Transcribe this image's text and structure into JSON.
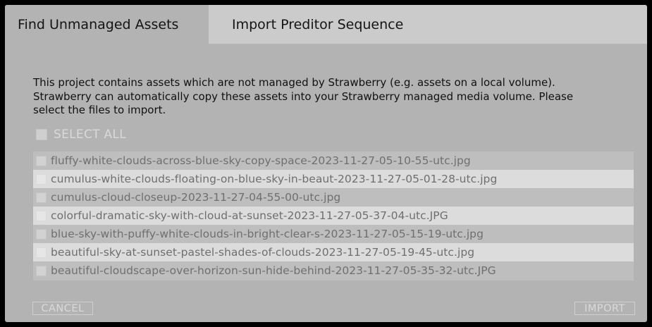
{
  "tabs": [
    {
      "label": "Find Unmanaged Assets",
      "active": true
    },
    {
      "label": "Import Preditor Sequence",
      "active": false
    }
  ],
  "description": [
    "This project contains assets which are not managed by Strawberry (e.g. assets on a local volume).",
    "Strawberry can automatically copy these assets into your Strawberry managed media volume. Please",
    "select the files to import."
  ],
  "select_all_label": "SELECT ALL",
  "files": [
    "fluffy-white-clouds-across-blue-sky-copy-space-2023-11-27-05-10-55-utc.jpg",
    "cumulus-white-clouds-floating-on-blue-sky-in-beaut-2023-11-27-05-01-28-utc.jpg",
    "cumulus-cloud-closeup-2023-11-27-04-55-00-utc.jpg",
    "colorful-dramatic-sky-with-cloud-at-sunset-2023-11-27-05-37-04-utc.JPG",
    "blue-sky-with-puffy-white-clouds-in-bright-clear-s-2023-11-27-05-15-19-utc.jpg",
    "beautiful-sky-at-sunset-pastel-shades-of-clouds-2023-11-27-05-19-45-utc.jpg",
    "beautiful-cloudscape-over-horizon-sun-hide-behind-2023-11-27-05-35-32-utc.JPG"
  ],
  "buttons": {
    "cancel": "CANCEL",
    "import": "IMPORT"
  },
  "colors": {
    "panel": "#b3b3b3",
    "tabbar": "#cbcbcb",
    "row_alt": "#dcdcdc"
  }
}
